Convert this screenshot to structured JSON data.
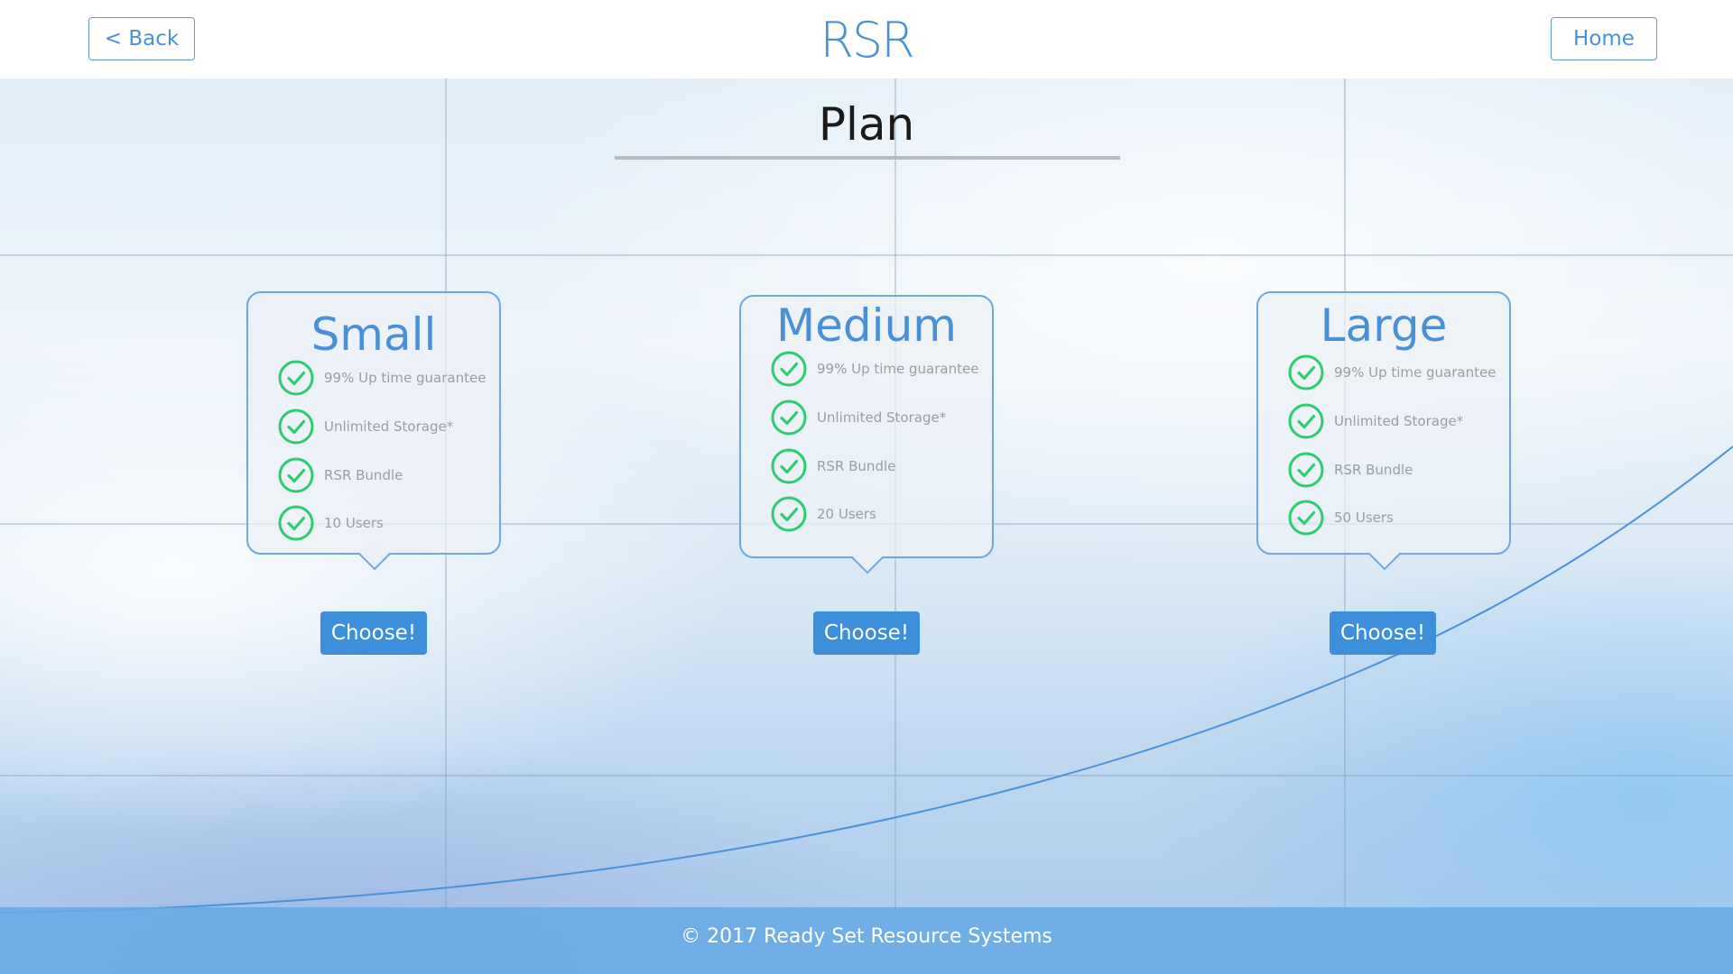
{
  "header": {
    "back_label": "< Back",
    "logo": "RSR",
    "home_label": "Home"
  },
  "page": {
    "title": "Plan"
  },
  "plans": [
    {
      "name": "Small",
      "features": [
        "99% Up time guarantee",
        "Unlimited Storage*",
        "RSR Bundle",
        "10 Users"
      ],
      "button": "Choose!"
    },
    {
      "name": "Medium",
      "features": [
        "99% Up time guarantee",
        "Unlimited Storage*",
        "RSR Bundle",
        "20 Users"
      ],
      "button": "Choose!"
    },
    {
      "name": "Large",
      "features": [
        "99% Up time guarantee",
        "Unlimited Storage*",
        "RSR Bundle",
        "50 Users"
      ],
      "button": "Choose!"
    }
  ],
  "footer": {
    "text": "© 2017 Ready Set Resource Systems"
  },
  "colors": {
    "accent": "#4a90d9",
    "button": "#3d8fdc",
    "check": "#2ecc71",
    "footer": "#68aae6"
  },
  "icons": {
    "feature_check": "check-circle-icon"
  }
}
